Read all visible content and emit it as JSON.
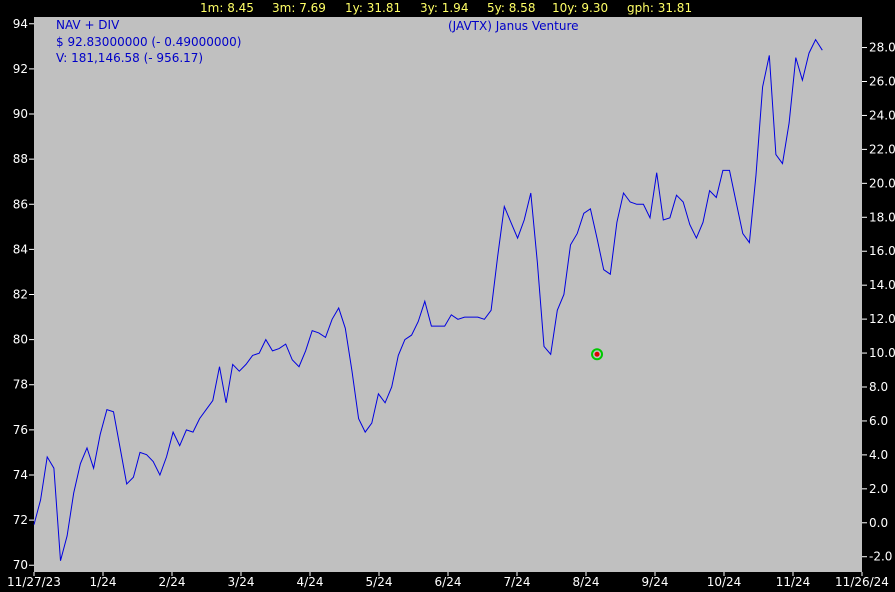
{
  "stats": [
    {
      "label": "1m:",
      "value": "8.45"
    },
    {
      "label": "3m:",
      "value": "7.69"
    },
    {
      "label": "1y:",
      "value": "31.81"
    },
    {
      "label": "3y:",
      "value": "1.94"
    },
    {
      "label": "5y:",
      "value": "8.58"
    },
    {
      "label": "10y:",
      "value": "9.30"
    },
    {
      "label": "gph:",
      "value": "31.81"
    }
  ],
  "legend": {
    "line1": "NAV + DIV",
    "line2": "$ 92.83000000 (- 0.49000000)",
    "line3": "V: 181,146.58 (- 956.17)"
  },
  "chart_data": {
    "type": "line",
    "title": "(JAVTX) Janus Venture",
    "series_color": "#0000e0",
    "background": "#c0c0c0",
    "grid": false,
    "x_tick_labels": [
      "11/27/23",
      "1/24",
      "2/24",
      "3/24",
      "4/24",
      "5/24",
      "6/24",
      "7/24",
      "8/24",
      "9/24",
      "10/24",
      "11/24",
      "11/26/24"
    ],
    "y_left": {
      "ylim": [
        69.7,
        94.3
      ],
      "ticks": [
        70,
        72,
        74,
        76,
        78,
        80,
        82,
        84,
        86,
        88,
        90,
        92,
        94
      ]
    },
    "y_right": {
      "ylim": [
        -2.9,
        29.8
      ],
      "tick_labels": [
        "-2.0",
        "0.0",
        "2.0",
        "4.0",
        "6.0",
        "8.0",
        "10.0",
        "12.0",
        "14.0",
        "16.0",
        "18.0",
        "20.0",
        "22.0",
        "24.0",
        "26.0",
        "28.0"
      ]
    },
    "marker": {
      "x": 170,
      "y": 79.35,
      "color": "#00c800"
    },
    "x": [
      0,
      2,
      4,
      6,
      8,
      10,
      12,
      14,
      16,
      18,
      20,
      22,
      24,
      26,
      28,
      30,
      32,
      34,
      36,
      38,
      40,
      42,
      44,
      46,
      48,
      50,
      52,
      54,
      56,
      58,
      60,
      62,
      64,
      66,
      68,
      70,
      72,
      74,
      76,
      78,
      80,
      82,
      84,
      86,
      88,
      90,
      92,
      94,
      96,
      98,
      100,
      102,
      104,
      106,
      108,
      110,
      112,
      114,
      116,
      118,
      120,
      122,
      124,
      126,
      128,
      130,
      132,
      134,
      136,
      138,
      140,
      142,
      144,
      146,
      148,
      150,
      152,
      154,
      156,
      158,
      160,
      162,
      164,
      166,
      168,
      170,
      172,
      174,
      176,
      178,
      180,
      182,
      184,
      186,
      188,
      190,
      192,
      194,
      196,
      198,
      200,
      202,
      204,
      206,
      208,
      210,
      212,
      214,
      216,
      218,
      220,
      222,
      224,
      226,
      228,
      230,
      232,
      234,
      236,
      238,
      240,
      242,
      244,
      246,
      248,
      250
    ],
    "y": [
      71.8,
      72.9,
      74.8,
      74.3,
      70.2,
      71.3,
      73.2,
      74.5,
      75.2,
      74.3,
      75.8,
      76.9,
      76.8,
      75.2,
      73.6,
      73.9,
      75.0,
      74.9,
      74.6,
      74.0,
      74.8,
      75.9,
      75.3,
      76.0,
      75.9,
      76.5,
      76.9,
      77.3,
      78.8,
      77.2,
      78.9,
      78.6,
      78.9,
      79.3,
      79.4,
      80.0,
      79.5,
      79.6,
      79.8,
      79.1,
      78.8,
      79.5,
      80.4,
      80.3,
      80.1,
      80.9,
      81.4,
      80.5,
      78.6,
      76.5,
      75.9,
      76.3,
      77.6,
      77.2,
      77.9,
      79.3,
      80.0,
      80.2,
      80.8,
      81.7,
      80.6,
      80.6,
      80.6,
      81.1,
      80.9,
      81.0,
      81.0,
      81.0,
      80.9,
      81.3,
      83.7,
      85.9,
      85.2,
      84.5,
      85.3,
      86.5,
      83.4,
      79.7,
      79.35,
      81.3,
      82.0,
      84.2,
      84.7,
      85.6,
      85.8,
      84.5,
      83.1,
      82.9,
      85.2,
      86.5,
      86.1,
      86.0,
      86.0,
      85.4,
      87.4,
      85.3,
      85.4,
      86.4,
      86.1,
      85.1,
      84.5,
      85.2,
      86.6,
      86.3,
      87.5,
      87.5,
      86.1,
      84.7,
      84.3,
      87.3,
      91.2,
      92.6,
      88.2,
      87.8,
      89.6,
      92.5,
      91.5,
      92.7,
      93.3,
      92.83
    ]
  }
}
